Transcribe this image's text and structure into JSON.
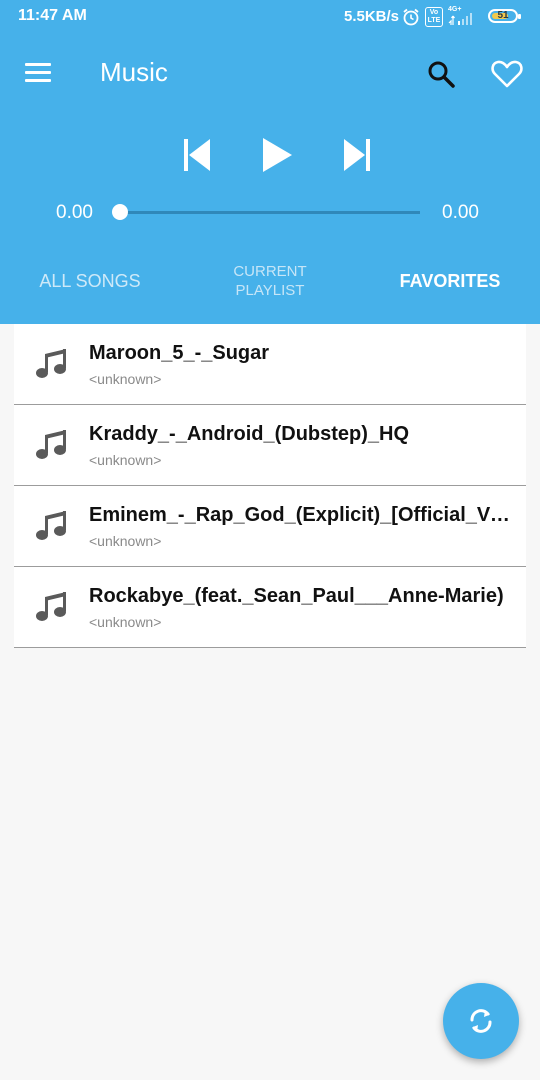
{
  "status_bar": {
    "time": "11:47 AM",
    "net_speed": "5.5KB/s",
    "volte": "Vo LTE",
    "network": "4G+",
    "battery": "51",
    "icons": [
      "alarm-icon",
      "volte-icon",
      "signal-icon",
      "battery-icon"
    ]
  },
  "app_bar": {
    "title": "Music",
    "icons": [
      "menu-icon",
      "search-icon",
      "heart-icon"
    ]
  },
  "player": {
    "elapsed": "0.00",
    "duration": "0.00",
    "progress": 0,
    "controls": [
      "previous-icon",
      "play-icon",
      "next-icon"
    ]
  },
  "tabs": {
    "all_songs": "ALL SONGS",
    "current_line1": "CURRENT",
    "current_line2": "PLAYLIST",
    "favorites": "FAVORITES",
    "selected": "FAVORITES"
  },
  "songs": [
    {
      "title": "Maroon_5_-_Sugar",
      "artist": "<unknown>"
    },
    {
      "title": "Kraddy_-_Android_(Dubstep)_HQ",
      "artist": "<unknown>"
    },
    {
      "title": "Eminem_-_Rap_God_(Explicit)_[Official_Video]",
      "artist": "<unknown>"
    },
    {
      "title": "Rockabye_(feat._Sean_Paul___Anne-Marie)",
      "artist": "<unknown>"
    }
  ],
  "fab": {
    "icon": "refresh-icon"
  },
  "colors": {
    "primary": "#46b1ea",
    "seek_track": "#2f88ba",
    "icon_gray": "#5a5a5a"
  }
}
